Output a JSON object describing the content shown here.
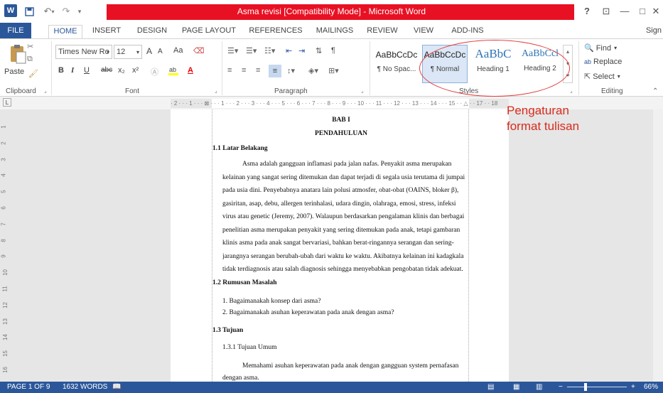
{
  "window": {
    "title": "Asma revisi [Compatibility Mode] - Microsoft Word",
    "help": "?",
    "controls": [
      "—",
      "□",
      "✕"
    ]
  },
  "quick_access": {
    "save_icon": "save-icon",
    "undo_icon": "undo-icon",
    "redo_icon": "redo-icon"
  },
  "tabs": {
    "file": "FILE",
    "items": [
      "HOME",
      "INSERT",
      "DESIGN",
      "PAGE LAYOUT",
      "REFERENCES",
      "MAILINGS",
      "REVIEW",
      "VIEW",
      "ADD-INS"
    ],
    "active": "HOME",
    "signin": "Sign"
  },
  "ribbon": {
    "clipboard": {
      "label": "Clipboard",
      "paste": "Paste"
    },
    "font": {
      "label": "Font",
      "family": "Times New Ro",
      "size": "12",
      "grow": "A",
      "shrink": "A",
      "case": "Aa",
      "bold": "B",
      "italic": "I",
      "underline": "U",
      "strike": "abc",
      "subscript": "x₂",
      "superscript": "x²",
      "font_color": "A"
    },
    "paragraph": {
      "label": "Paragraph"
    },
    "styles": {
      "label": "Styles",
      "items": [
        {
          "sample": "AaBbCcDc",
          "name": "¶ No Spac..."
        },
        {
          "sample": "AaBbCcDc",
          "name": "¶ Normal"
        },
        {
          "sample": "AaBbC",
          "name": "Heading 1"
        },
        {
          "sample": "AaBbCcl",
          "name": "Heading 2"
        }
      ],
      "selected": "¶ Normal"
    },
    "editing": {
      "label": "Editing",
      "find": "Find",
      "replace": "Replace",
      "select": "Select"
    }
  },
  "annotation": {
    "line1": "Pengaturan",
    "line2": "format tulisan"
  },
  "ruler": {
    "horizontal": "· 2 · · · 1 · · · ⊠ · · · 1 · · · 2 · · · 3 · · · 4 · · · 5 · · · 6 · · · 7 · · · 8 · · · 9 · · · 10 · · · 11 · · · 12 · · · 13 · · · 14 · · · 15 · · △ · · 17 · · 18",
    "vertical": [
      "1",
      "2",
      "3",
      "4",
      "5",
      "6",
      "7",
      "8",
      "9",
      "10",
      "11",
      "12",
      "13",
      "14",
      "15",
      "16"
    ]
  },
  "document": {
    "bab": "BAB I",
    "chapter": "PENDAHULUAN",
    "h1": "1.1 Latar Belakang",
    "para1": [
      "Asma adalah gangguan inflamasi pada jalan nafas. Penyakit asma merupakan",
      "kelainan yang sangat sering ditemukan dan dapat terjadi di segala usia terutama di jumpai",
      "pada usia dini. Penyebabnya anatara lain polusi atmosfer, obat-obat (OAINS, bloker β),",
      "gasiritan, asap, debu, allergen terinhalasi, udara dingin, olahraga, emosi, stress, infeksi",
      "virus atau genetic (Jeremy, 2007). Walaupun berdasarkan pengalaman klinis dan berbagai",
      "penelitian asma merupakan penyakit yang sering ditemukan pada anak, tetapi gambaran",
      "klinis asma pada anak sangat bervariasi, bahkan berat-ringannya serangan dan sering-",
      "jarangnya serangan berubah-ubah dari waktu ke waktu. Akibatnya kelainan ini kadagkala",
      "tidak terdiagnosis atau salah diagnosis sehingga menyebabkan pengobatan tidak adekuat."
    ],
    "h2": "1.2 Rumusan Masalah",
    "list": [
      "1.   Bagaimanakah konsep dari asma?",
      "2.   Bagaimanakah asuhan keperawatan pada anak dengan asma?"
    ],
    "h3": "1.3 Tujuan",
    "h31": "1.3.1 Tujuan Umum",
    "para2": [
      "Memahami asuhan keperawatan pada anak dengan gangguan system pernafasan",
      "dengan asma."
    ]
  },
  "status": {
    "page": "PAGE 1 OF 9",
    "words": "1632 WORDS",
    "zoom": "66%",
    "zoom_level": 0.66
  },
  "colors": {
    "word_blue": "#2b579a",
    "title_red": "#e81123",
    "annotation_red": "#d92b1c"
  }
}
